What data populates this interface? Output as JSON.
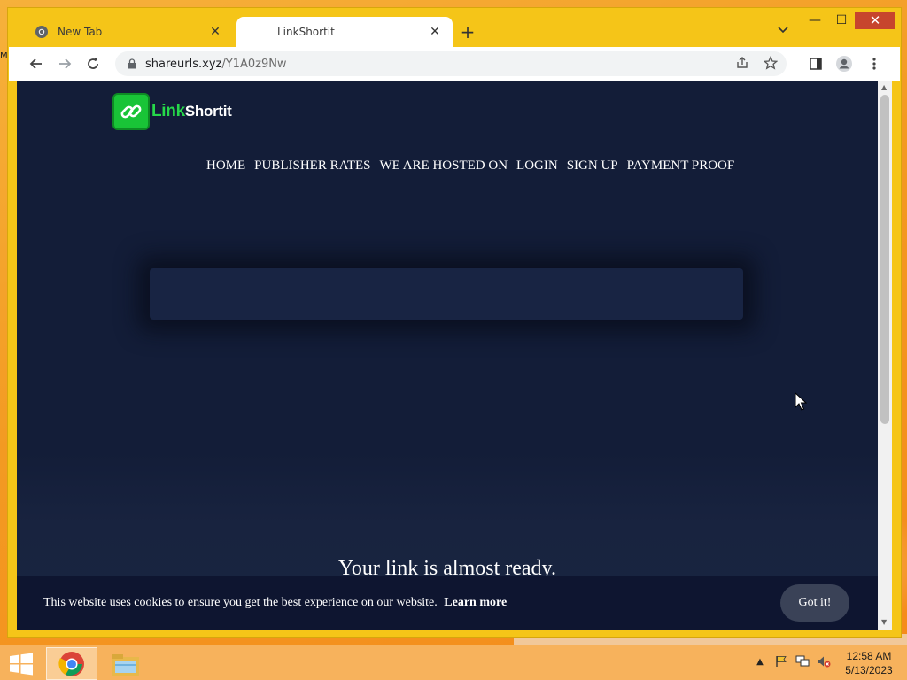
{
  "browser": {
    "tabs": [
      {
        "label": "New Tab",
        "active": false,
        "icon": "chrome-icon"
      },
      {
        "label": "LinkShortit",
        "active": true,
        "icon": "none"
      }
    ],
    "new_tab_symbol": "+",
    "address": {
      "host": "shareurls.xyz",
      "path": "/Y1A0z9Nw"
    },
    "window_controls": {
      "minimize": "—",
      "maximize": "☐",
      "close": "✕"
    }
  },
  "page": {
    "logo": {
      "part1": "Link",
      "part2": "Shortit"
    },
    "nav": [
      "HOME",
      "PUBLISHER RATES",
      "WE ARE HOSTED ON",
      "LOGIN",
      "SIGN UP",
      "PAYMENT PROOF"
    ],
    "heading": "Your link is almost ready.",
    "cookie": {
      "message": "This website uses cookies to ensure you get the best experience on our website.",
      "learn_more": "Learn more",
      "button": "Got it!"
    }
  },
  "taskbar": {
    "time": "12:58 AM",
    "date": "5/13/2023"
  },
  "desktop": {
    "clipped_label": "M"
  },
  "colors": {
    "page_bg": "#131d38",
    "logo_green": "#19c437",
    "window_frame": "#f5c518",
    "close_red": "#c7452d",
    "taskbar": "#f7b25c"
  }
}
